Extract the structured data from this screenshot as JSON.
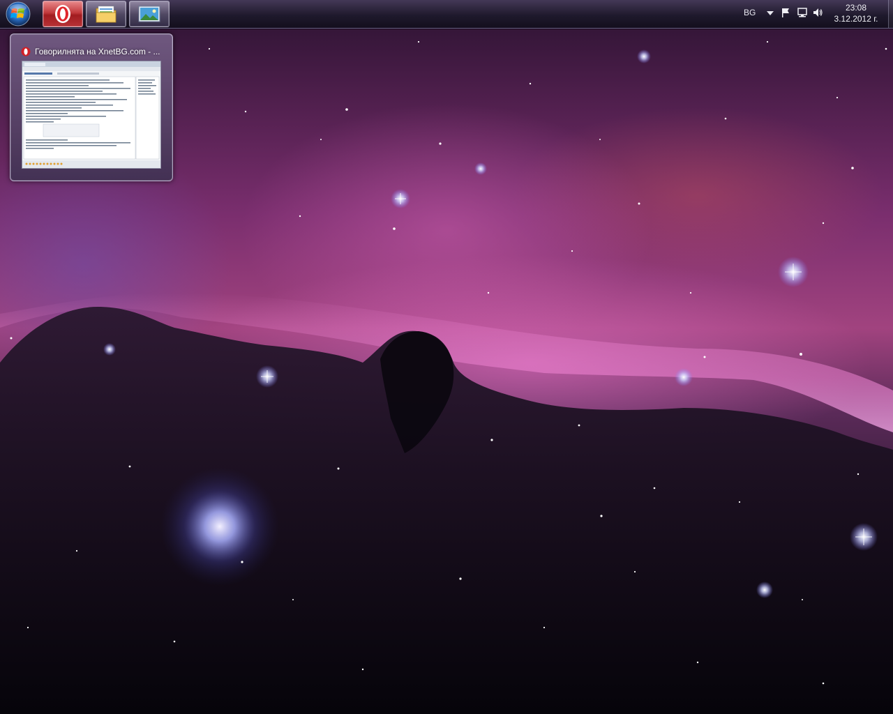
{
  "taskbar": {
    "start_button": {
      "icon": "windows-logo-icon"
    },
    "tasks": [
      {
        "name": "opera",
        "icon": "opera-icon",
        "active": true
      },
      {
        "name": "windows-explorer",
        "icon": "folder-icon",
        "active": false
      },
      {
        "name": "photo-viewer",
        "icon": "picture-icon",
        "active": false
      }
    ],
    "tray": {
      "language": "BG",
      "icons": [
        "chevron-down-icon",
        "action-center-flag-icon",
        "network-icon",
        "volume-icon"
      ],
      "time": "23:08",
      "date": "3.12.2012 г."
    }
  },
  "thumbnail": {
    "title": "Говорилнята на XnetBG.com - ...",
    "icon": "opera-icon"
  },
  "desktop": {
    "wallpaper": "horsehead-nebula"
  },
  "colors": {
    "taskbar_bg": "#1e1a2c",
    "opera_red": "#c23a3d",
    "nebula_pink": "#e070c8",
    "text_light": "#f0f0f5"
  }
}
